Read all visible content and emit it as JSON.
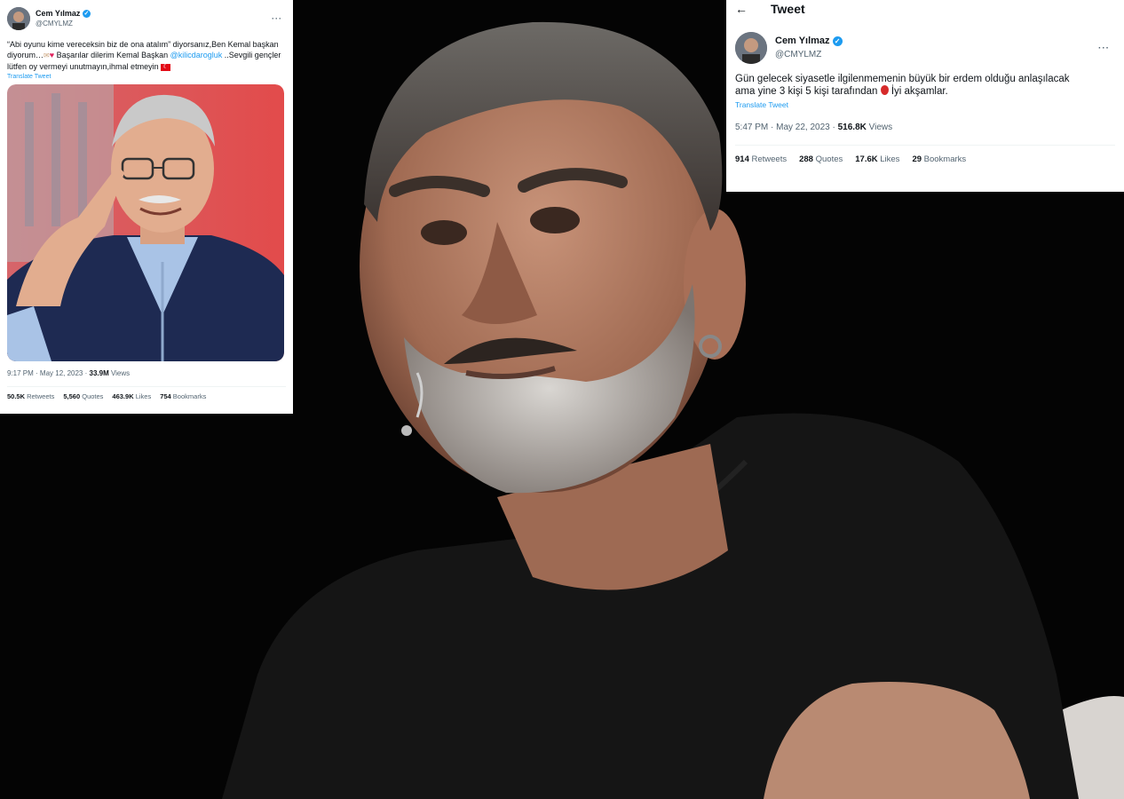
{
  "tweet_left": {
    "name": "Cem Yılmaz",
    "handle": "@CMYLMZ",
    "more": "···",
    "text_a": "“Abi oyunu kime vereceksin biz de ona atalım” diyorsanız,Ben Kemal başkan diyorum…",
    "text_b": " Başarılar dilerim Kemal Başkan ",
    "mention": "@kilicdarogluk",
    "text_c": " ..Sevgili gençler lütfen oy vermeyi unutmayın,ihmal etmeyin ",
    "translate": "Translate Tweet",
    "meta_time": "9:17 PM · May 12, 2023 · ",
    "views_value": "33.9M",
    "views_label": " Views",
    "stats": [
      {
        "value": "50.5K",
        "label": " Retweets"
      },
      {
        "value": "5,560",
        "label": " Quotes"
      },
      {
        "value": "463.9K",
        "label": " Likes"
      },
      {
        "value": "754",
        "label": " Bookmarks"
      }
    ]
  },
  "tweet_right": {
    "header_title": "Tweet",
    "back_arrow": "←",
    "name": "Cem Yılmaz",
    "handle": "@CMYLMZ",
    "more": "···",
    "text_a": "Gün gelecek siyasetle ilgilenmemenin büyük bir erdem olduğu anlaşılacak ama yine 3 kişi 5 kişi tarafından ",
    "text_b": " İyi akşamlar.",
    "translate": "Translate Tweet",
    "meta_time": "5:47 PM · May 22, 2023 · ",
    "views_value": "516.8K",
    "views_label": " Views",
    "stats": [
      {
        "value": "914",
        "label": " Retweets"
      },
      {
        "value": "288",
        "label": " Quotes"
      },
      {
        "value": "17.6K",
        "label": " Likes"
      },
      {
        "value": "29",
        "label": " Bookmarks"
      }
    ]
  },
  "colors": {
    "accent": "#1d9bf0",
    "background_photo": "#050505",
    "text_primary": "#0f1419",
    "text_secondary": "#536471"
  },
  "icons": [
    "verified-badge-icon",
    "more-options-icon",
    "back-arrow-icon",
    "heart-emoji-icon",
    "turkish-flag-emoji-icon",
    "balloon-emoji-icon"
  ]
}
